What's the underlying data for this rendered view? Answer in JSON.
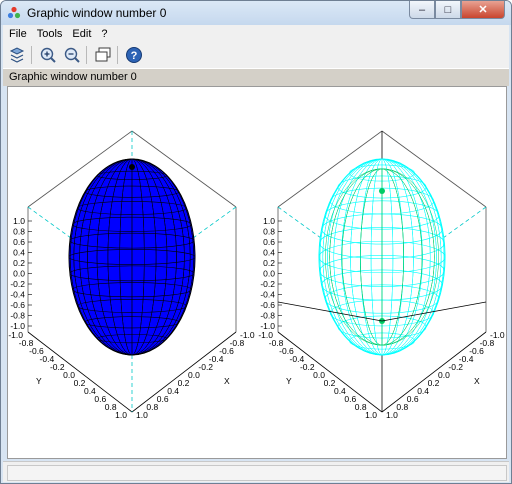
{
  "window": {
    "title": "Graphic window number 0",
    "controls": {
      "minimize": "–",
      "maximize": "□",
      "close": "✕"
    }
  },
  "menu": {
    "items": [
      {
        "label": "File",
        "name": "menu-file"
      },
      {
        "label": "Tools",
        "name": "menu-tools"
      },
      {
        "label": "Edit",
        "name": "menu-edit"
      },
      {
        "label": "?",
        "name": "menu-help"
      }
    ]
  },
  "toolbar": {
    "buttons": [
      {
        "name": "rotate-icon"
      },
      {
        "name": "zoom-in-icon"
      },
      {
        "name": "zoom-out-icon"
      },
      {
        "name": "select-window-icon"
      },
      {
        "name": "help-icon"
      }
    ]
  },
  "info": {
    "text": "Graphic window number 0"
  },
  "plots": [
    {
      "type": "surface-3d",
      "surface_color": "#0000ff",
      "edge_color": "#000000",
      "x_ticks": [
        "-1.0",
        "-0.8",
        "-0.6",
        "-0.4",
        "-0.2",
        "0.0",
        "0.2",
        "0.4",
        "0.6",
        "0.8",
        "1.0"
      ],
      "y_ticks": [
        "-1.0",
        "-0.8",
        "-0.6",
        "-0.4",
        "-0.2",
        "0.0",
        "0.2",
        "0.4",
        "0.6",
        "0.8",
        "1.0"
      ],
      "z_ticks": [
        "1.0",
        "0.8",
        "0.6",
        "0.4",
        "0.2",
        "0.0",
        "-0.2",
        "-0.4",
        "-0.6",
        "-0.8",
        "-1.0"
      ],
      "xlabel": "X",
      "ylabel": "Y"
    },
    {
      "type": "mesh-3d",
      "mesh_color": "#00ffff",
      "accent_color": "#00cc66",
      "x_ticks": [
        "-1.0",
        "-0.8",
        "-0.6",
        "-0.4",
        "-0.2",
        "0.0",
        "0.2",
        "0.4",
        "0.6",
        "0.8",
        "1.0"
      ],
      "y_ticks": [
        "-1.0",
        "-0.8",
        "-0.6",
        "-0.4",
        "-0.2",
        "0.0",
        "0.2",
        "0.4",
        "0.6",
        "0.8",
        "1.0"
      ],
      "z_ticks": [
        "1.0",
        "0.8",
        "0.6",
        "0.4",
        "0.2",
        "0.0",
        "-0.2",
        "-0.4",
        "-0.6",
        "-0.8",
        "-1.0"
      ],
      "xlabel": "X",
      "ylabel": "Y"
    }
  ],
  "status": {
    "text": ""
  }
}
